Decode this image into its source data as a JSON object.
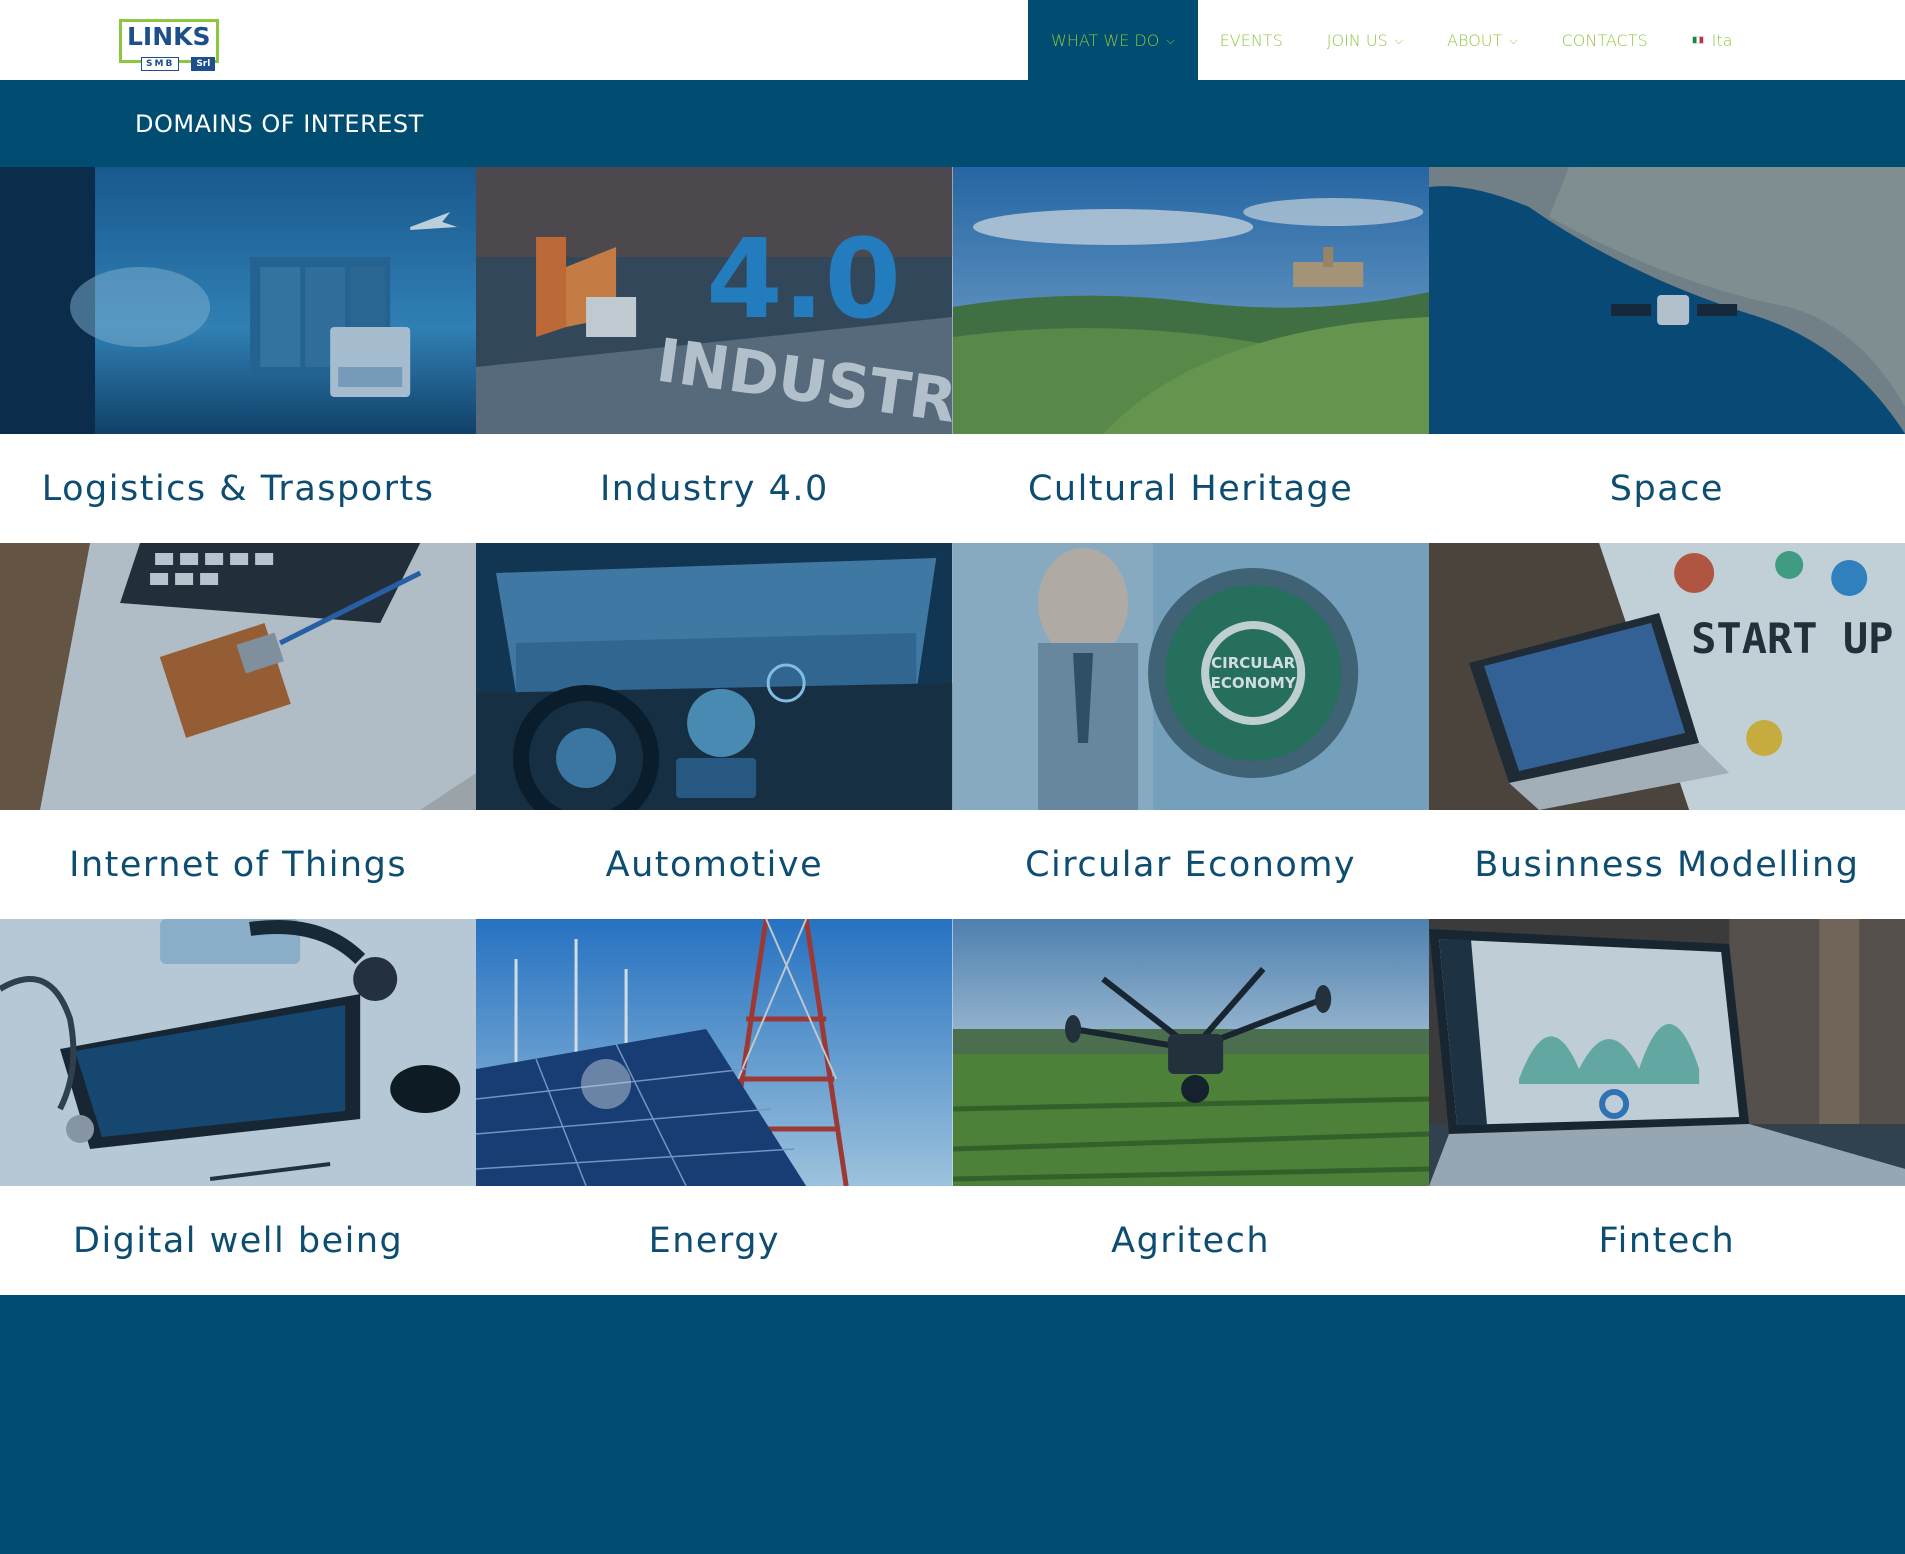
{
  "logo": {
    "main": "LINKS",
    "sub": [
      "SMB",
      "Srl"
    ]
  },
  "nav": {
    "items": [
      {
        "label": "WHAT WE DO",
        "dropdown": true,
        "active": true
      },
      {
        "label": "EVENTS",
        "dropdown": false
      },
      {
        "label": "JOIN US",
        "dropdown": true
      },
      {
        "label": "ABOUT",
        "dropdown": true
      },
      {
        "label": "CONTACTS",
        "dropdown": false
      }
    ],
    "language": {
      "label": "Ita",
      "flag_icon": "italian-flag-icon"
    }
  },
  "page": {
    "title": "DOMAINS OF INTEREST"
  },
  "colors": {
    "brand_blue": "#004d71",
    "brand_green": "#8dc63f",
    "caption_text": "#0e4d72"
  },
  "domains": [
    {
      "label": "Logistics & Trasports",
      "image": "logistics-photo"
    },
    {
      "label": "Industry 4.0",
      "image": "industry-photo"
    },
    {
      "label": "Cultural Heritage",
      "image": "vineyard-photo"
    },
    {
      "label": "Space",
      "image": "satellite-photo"
    },
    {
      "label": "Internet of Things",
      "image": "circuit-board-photo"
    },
    {
      "label": "Automotive",
      "image": "car-dashboard-photo"
    },
    {
      "label": "Circular Economy",
      "image": "circular-economy-photo"
    },
    {
      "label": "Businness Modelling",
      "image": "startup-photo"
    },
    {
      "label": "Digital well being",
      "image": "medical-tablet-photo"
    },
    {
      "label": "Energy",
      "image": "energy-photo"
    },
    {
      "label": "Agritech",
      "image": "drone-photo"
    },
    {
      "label": "Fintech",
      "image": "laptop-dashboard-photo"
    }
  ]
}
